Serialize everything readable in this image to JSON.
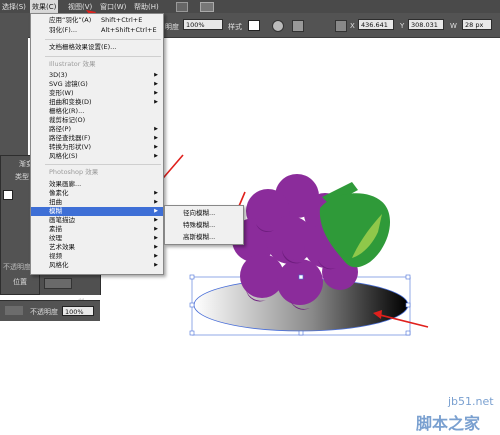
{
  "menubar": {
    "items": [
      {
        "label": "选择(S)"
      },
      {
        "label": "效果(C)"
      },
      {
        "label": "视图(V)"
      },
      {
        "label": "窗口(W)"
      },
      {
        "label": "帮助(H)"
      }
    ]
  },
  "controlbar": {
    "opacity_value": "100%",
    "style_label": "样式",
    "x_value": "436.641",
    "y_value": "308.031",
    "w_value": "28 px",
    "opacity_label_partial": "明度"
  },
  "effect_menu": {
    "items": [
      {
        "label": "应用“羽化”(A)",
        "shortcut": "Shift+Ctrl+E"
      },
      {
        "label": "羽化(F)...",
        "shortcut": "Alt+Shift+Ctrl+E"
      },
      {
        "label": "文档栅格效果设置(E)..."
      },
      {
        "label": "Illustrator 效果"
      },
      {
        "label": "3D(3)"
      },
      {
        "label": "SVG 滤镜(G)"
      },
      {
        "label": "变形(W)"
      },
      {
        "label": "扭曲和变换(D)"
      },
      {
        "label": "栅格化(R)..."
      },
      {
        "label": "裁剪标记(O)"
      },
      {
        "label": "路径(P)"
      },
      {
        "label": "路径查找器(F)"
      },
      {
        "label": "转换为形状(V)"
      },
      {
        "label": "风格化(S)"
      },
      {
        "label": "Photoshop 效果"
      },
      {
        "label": "效果画廊..."
      },
      {
        "label": "像素化"
      },
      {
        "label": "扭曲"
      },
      {
        "label": "模糊"
      },
      {
        "label": "画笔描边"
      },
      {
        "label": "素描"
      },
      {
        "label": "纹理"
      },
      {
        "label": "艺术效果"
      },
      {
        "label": "视频"
      },
      {
        "label": "风格化"
      }
    ]
  },
  "blur_submenu": {
    "items": [
      {
        "label": "径向模糊..."
      },
      {
        "label": "特殊模糊..."
      },
      {
        "label": "高斯模糊..."
      }
    ]
  },
  "left_panel": {
    "tab_label": "渐变",
    "type_label": "类型",
    "opacity_label": "不透明度",
    "position_label": "位置"
  },
  "bottom_bar": {
    "opacity_label": "不透明度",
    "opacity_value": "100%"
  },
  "watermark": {
    "site": "jb51.net",
    "name": "脚本之家"
  },
  "colors": {
    "grape": "#8b2c9b",
    "grape_dark": "#6e1d7e",
    "leaf": "#2f9a39",
    "highlight": "#3e6fd6",
    "arrow": "#e0201c",
    "selection": "#4a6fd8"
  }
}
